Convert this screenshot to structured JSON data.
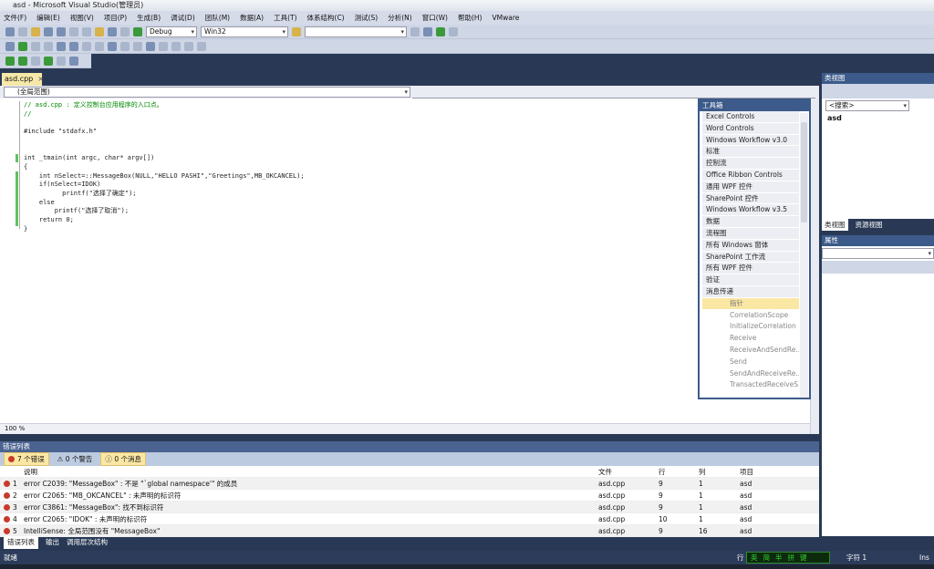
{
  "window": {
    "title": "asd - Microsoft Visual Studio(管理员)"
  },
  "menu": [
    "文件(F)",
    "编辑(E)",
    "视图(V)",
    "项目(P)",
    "生成(B)",
    "调试(D)",
    "团队(M)",
    "数据(A)",
    "工具(T)",
    "体系结构(C)",
    "测试(S)",
    "分析(N)",
    "窗口(W)",
    "帮助(H)",
    "VMware"
  ],
  "toolbar": {
    "config": "Debug",
    "platform": "Win32",
    "find": ""
  },
  "editor": {
    "tab": "asd.cpp",
    "close": "×",
    "scope": "(全局范围)",
    "zoom": "100 %",
    "lines": [
      "// asd.cpp : 定义控制台应用程序的入口点。",
      "//",
      "",
      "#include \"stdafx.h\"",
      "",
      "",
      "int _tmain(int argc, char* argv[])",
      "{",
      "    int nSelect=::MessageBox(NULL,\"HELLO PASHI\",\"Greetings\",MB_OKCANCEL);",
      "    if(nSelect=IDOK)",
      "          printf(\"选择了确定\");",
      "    else",
      "        printf(\"选择了取消\");",
      "    return 0;",
      "}"
    ]
  },
  "toolbox": {
    "title": "工具箱",
    "groups": [
      "Excel Controls",
      "Word Controls",
      "Windows Workflow v3.0",
      "标准",
      "控制流",
      "Office Ribbon Controls",
      "通用 WPF 控件",
      "SharePoint 控件",
      "Windows Workflow v3.5",
      "数据",
      "流程图",
      "所有 Windows 窗体",
      "SharePoint 工作流",
      "所有 WPF 控件",
      "验证",
      "消息传递"
    ],
    "items": [
      "指针",
      "CorrelationScope",
      "InitializeCorrelation",
      "Receive",
      "ReceiveAndSendRe...",
      "Send",
      "SendAndReceiveRe...",
      "TransactedReceiveS..."
    ]
  },
  "classview": {
    "title": "类视图",
    "search": "<搜索>",
    "node": "asd",
    "tabs": [
      "类视图",
      "资源视图"
    ]
  },
  "properties": {
    "title": "属性"
  },
  "errorlist": {
    "title": "错误列表",
    "filters": [
      "7 个错误",
      "0 个警告",
      "0 个消息"
    ],
    "columns": [
      "",
      "说明",
      "文件",
      "行",
      "列",
      "项目"
    ],
    "rows": [
      [
        "1",
        "error C2039: \"MessageBox\" : 不是 \"`global namespace'\" 的成员",
        "asd.cpp",
        "9",
        "1",
        "asd"
      ],
      [
        "2",
        "error C2065: \"MB_OKCANCEL\" : 未声明的标识符",
        "asd.cpp",
        "9",
        "1",
        "asd"
      ],
      [
        "3",
        "error C3861: \"MessageBox\": 找不到标识符",
        "asd.cpp",
        "9",
        "1",
        "asd"
      ],
      [
        "4",
        "error C2065: \"IDOK\" : 未声明的标识符",
        "asd.cpp",
        "10",
        "1",
        "asd"
      ],
      [
        "5",
        "IntelliSense: 全局范围没有 \"MessageBox\"",
        "asd.cpp",
        "9",
        "16",
        "asd"
      ]
    ]
  },
  "bottom_tabs": [
    "错误列表",
    "输出",
    "调用层次结构"
  ],
  "status": {
    "text": "就绪",
    "line": "行",
    "char": "字符 1",
    "mode": "Ins",
    "ime": [
      "英",
      "简",
      "半",
      "拼",
      "键"
    ]
  }
}
